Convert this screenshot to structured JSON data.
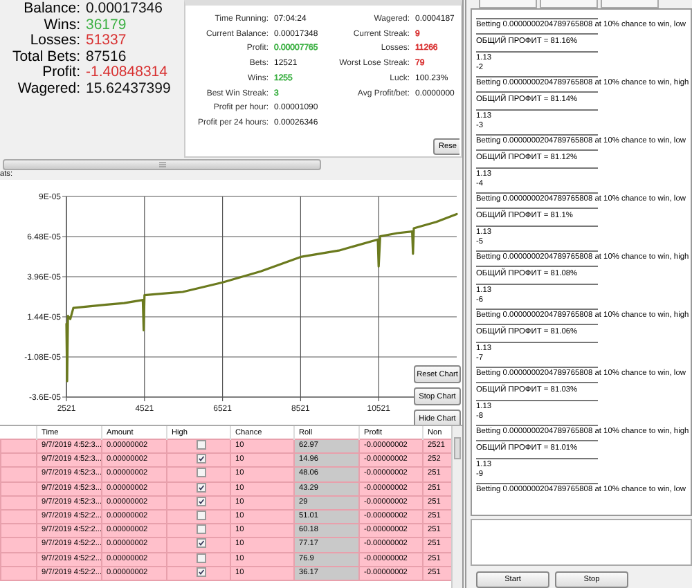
{
  "summary": [
    {
      "label": "Balance:",
      "value": "0.00017346"
    },
    {
      "label": "Wins:",
      "value": "36179",
      "color": "#3cb043"
    },
    {
      "label": "Losses:",
      "value": "51337",
      "color": "#d83030"
    },
    {
      "label": "Total Bets:",
      "value": "87516"
    },
    {
      "label": "Profit:",
      "value": "-1.40848314",
      "color": "#d83030"
    },
    {
      "label": "Wagered:",
      "value": "15.62437399"
    }
  ],
  "session": {
    "left": [
      {
        "label": "Time Running:",
        "value": "07:04:24"
      },
      {
        "label": "Current Balance:",
        "value": "0.00017348"
      },
      {
        "label": "Profit:",
        "value": "0.00007765",
        "color": "#3cb043"
      },
      {
        "label": "Bets:",
        "value": "12521"
      },
      {
        "label": "Wins:",
        "value": "1255",
        "color": "#3cb043"
      },
      {
        "label": "Best Win Streak:",
        "value": "3",
        "color": "#3cb043"
      },
      {
        "label": "Profit per hour:",
        "value": "0.00001090"
      },
      {
        "label": "Profit per 24 hours:",
        "value": "0.00026346"
      }
    ],
    "right": [
      {
        "label": "Wagered:",
        "value": "0.0004187"
      },
      {
        "label": "Current Streak:",
        "value": "9",
        "color": "#d83030"
      },
      {
        "label": "Losses:",
        "value": "11266",
        "color": "#d83030"
      },
      {
        "label": "Worst Lose Streak:",
        "value": "79",
        "color": "#d83030"
      },
      {
        "label": "Luck:",
        "value": "100.23%"
      },
      {
        "label": "Avg Profit/bet:",
        "value": "0.0000000"
      }
    ],
    "reset_button": "Rese"
  },
  "stats_label": "ats:",
  "chart": {
    "chart_data": {
      "type": "line",
      "x": [
        2521,
        2540,
        2560,
        2620,
        2700,
        3500,
        4000,
        4480,
        4500,
        4521,
        5500,
        6521,
        7500,
        8521,
        9500,
        10500,
        10521,
        10560,
        11000,
        11380,
        11400,
        11420,
        12000,
        12521
      ],
      "series": [
        {
          "color": "#6b7a1e",
          "values": [
            1e-05,
            -2.6e-05,
            1.5e-05,
            1.3e-05,
            2e-05,
            2.2e-05,
            2.3e-05,
            2.5e-05,
            6e-06,
            2.8e-05,
            3e-05,
            3.6e-05,
            4.3e-05,
            5.2e-05,
            5.6e-05,
            6.3e-05,
            4.6e-05,
            6.5e-05,
            6.7e-05,
            6.8e-05,
            5.4e-05,
            7e-05,
            7.4e-05,
            7.9e-05
          ]
        }
      ],
      "grid": true,
      "xlim": [
        2521,
        12521
      ],
      "ylim": [
        -3.6e-05,
        9e-05
      ],
      "xticks": [
        2521,
        4521,
        6521,
        8521,
        10521
      ],
      "yticks": [
        {
          "value": 9e-05,
          "label": "9E-05"
        },
        {
          "value": 6.48e-05,
          "label": "6.48E-05"
        },
        {
          "value": 3.96e-05,
          "label": "3.96E-05"
        },
        {
          "value": 1.44e-05,
          "label": "1.44E-05"
        },
        {
          "value": -1.08e-05,
          "label": "-1.08E-05"
        },
        {
          "value": -3.6e-05,
          "label": "-3.6E-05"
        }
      ]
    },
    "buttons": [
      "Reset Chart",
      "Stop Chart",
      "Hide Chart"
    ]
  },
  "table": {
    "columns": [
      "Time",
      "Amount",
      "High",
      "Chance",
      "Roll",
      "Profit",
      "Non"
    ],
    "rows": [
      {
        "lost": true,
        "time": "9/7/2019 4:52:3...",
        "amount": "0.00000002",
        "high": false,
        "chance": "10",
        "roll": "62.97",
        "profit": "-0.00000002",
        "column_8": "2521"
      },
      {
        "lost": true,
        "time": "9/7/2019 4:52:3...",
        "amount": "0.00000002",
        "high": true,
        "chance": "10",
        "roll": "14.96",
        "profit": "-0.00000002",
        "column_8": "252"
      },
      {
        "lost": true,
        "time": "9/7/2019 4:52:3...",
        "amount": "0.00000002",
        "high": false,
        "chance": "10",
        "roll": "48.06",
        "profit": "-0.00000002",
        "column_8": "251"
      },
      {
        "lost": true,
        "time": "9/7/2019 4:52:3...",
        "amount": "0.00000002",
        "high": true,
        "chance": "10",
        "roll": "43.29",
        "profit": "-0.00000002",
        "column_8": "251"
      },
      {
        "lost": true,
        "time": "9/7/2019 4:52:3...",
        "amount": "0.00000002",
        "high": true,
        "chance": "10",
        "roll": "29",
        "profit": "-0.00000002",
        "column_8": "251"
      },
      {
        "lost": true,
        "time": "9/7/2019 4:52:2...",
        "amount": "0.00000002",
        "high": false,
        "chance": "10",
        "roll": "51.01",
        "profit": "-0.00000002",
        "column_8": "251"
      },
      {
        "lost": true,
        "time": "9/7/2019 4:52:2...",
        "amount": "0.00000002",
        "high": false,
        "chance": "10",
        "roll": "60.18",
        "profit": "-0.00000002",
        "column_8": "251"
      },
      {
        "lost": true,
        "time": "9/7/2019 4:52:2...",
        "amount": "0.00000002",
        "high": true,
        "chance": "10",
        "roll": "77.17",
        "profit": "-0.00000002",
        "column_8": "251"
      },
      {
        "lost": true,
        "time": "9/7/2019 4:52:2...",
        "amount": "0.00000002",
        "high": false,
        "chance": "10",
        "roll": "76.9",
        "profit": "-0.00000002",
        "column_8": "251"
      },
      {
        "lost": true,
        "time": "9/7/2019 4:52:2...",
        "amount": "0.00000002",
        "high": true,
        "chance": "10",
        "roll": "36.17",
        "profit": "-0.00000002",
        "column_8": "251"
      }
    ]
  },
  "log": {
    "entries": [
      {
        "betting": "Betting 0.0000000204789765808 at 10% chance to win, low",
        "profit": "ОБЩИЙ ПРОФИТ = 81.16%",
        "lines": [
          "1.13",
          "-2"
        ]
      },
      {
        "betting": "Betting 0.0000000204789765808 at 10% chance to win, high",
        "profit": "ОБЩИЙ ПРОФИТ = 81.14%",
        "lines": [
          "1.13",
          "-3"
        ]
      },
      {
        "betting": "Betting 0.0000000204789765808 at 10% chance to win, low",
        "profit": "ОБЩИЙ ПРОФИТ = 81.12%",
        "lines": [
          "1.13",
          "-4"
        ]
      },
      {
        "betting": "Betting 0.0000000204789765808 at 10% chance to win, low",
        "profit": "ОБЩИЙ ПРОФИТ = 81.1%",
        "lines": [
          "1.13",
          "-5"
        ]
      },
      {
        "betting": "Betting 0.0000000204789765808 at 10% chance to win, high",
        "profit": "ОБЩИЙ ПРОФИТ = 81.08%",
        "lines": [
          "1.13",
          "-6"
        ]
      },
      {
        "betting": "Betting 0.0000000204789765808 at 10% chance to win, high",
        "profit": "ОБЩИЙ ПРОФИТ = 81.06%",
        "lines": [
          "1.13",
          "-7"
        ]
      },
      {
        "betting": "Betting 0.0000000204789765808 at 10% chance to win, low",
        "profit": "ОБЩИЙ ПРОФИТ = 81.03%",
        "lines": [
          "1.13",
          "-8"
        ]
      },
      {
        "betting": "Betting 0.0000000204789765808 at 10% chance to win, high",
        "profit": "ОБЩИЙ ПРОФИТ = 81.01%",
        "lines": [
          "1.13",
          "-9"
        ]
      },
      {
        "betting": "Betting 0.0000000204789765808 at 10% chance to win, low"
      }
    ]
  },
  "buttons": [
    "Start",
    "Stop"
  ]
}
